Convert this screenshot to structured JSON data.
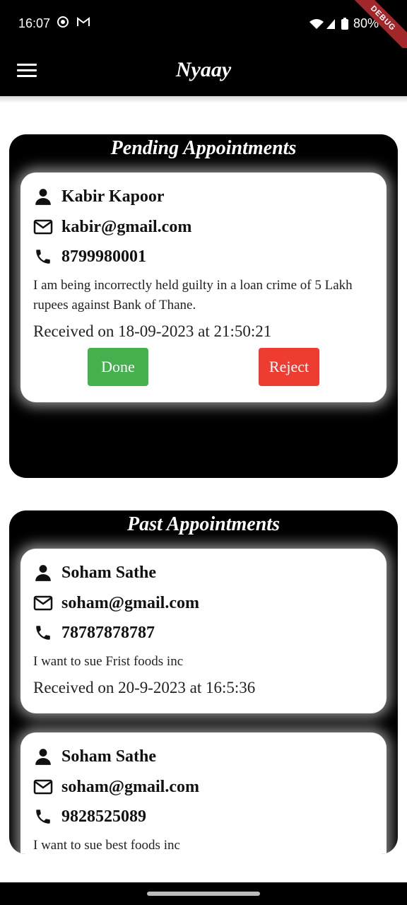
{
  "status": {
    "time": "16:07",
    "battery": "80%",
    "debug": "DEBUG"
  },
  "appbar": {
    "title": "Nyaay",
    "menu_icon": "menu-icon"
  },
  "pending": {
    "title": "Pending Appointments",
    "items": [
      {
        "name": "Kabir Kapoor",
        "email": "kabir@gmail.com",
        "phone": "8799980001",
        "message": "I am being incorrectly held guilty in a loan crime of 5 Lakh rupees against Bank of Thane.",
        "received": "Received on 18-09-2023 at 21:50:21",
        "done_label": "Done",
        "reject_label": "Reject"
      }
    ]
  },
  "past": {
    "title": "Past Appointments",
    "items": [
      {
        "name": "Soham Sathe",
        "email": "soham@gmail.com",
        "phone": "78787878787",
        "message": "I want to sue Frist foods inc",
        "received": "Received on 20-9-2023 at 16:5:36"
      },
      {
        "name": "Soham Sathe",
        "email": "soham@gmail.com",
        "phone": "9828525089",
        "message": "I want to sue best foods inc"
      }
    ]
  },
  "colors": {
    "done": "#45b04e",
    "reject": "#ee3c30",
    "panel": "#000000"
  }
}
